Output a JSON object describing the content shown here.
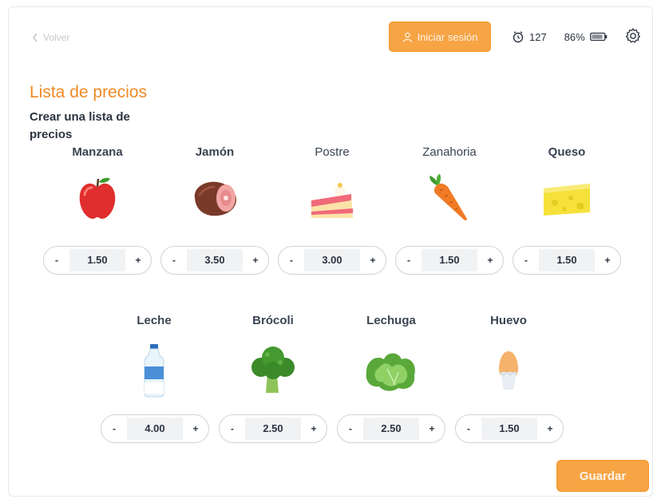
{
  "header": {
    "back_label": "Volver",
    "login_label": "Iniciar sesión",
    "counter": "127",
    "battery": "86%"
  },
  "page": {
    "title": "Lista de precios",
    "subtitle": "Crear una lista de precios"
  },
  "products": [
    {
      "name": "Manzana",
      "value": "1.50",
      "icon": "apple-icon"
    },
    {
      "name": "Jamón",
      "value": "3.50",
      "icon": "ham-icon"
    },
    {
      "name": "Postre",
      "value": "3.00",
      "icon": "cake-icon"
    },
    {
      "name": "Zanahoria",
      "value": "1.50",
      "icon": "carrot-icon"
    },
    {
      "name": "Queso",
      "value": "1.50",
      "icon": "cheese-icon"
    },
    {
      "name": "Leche",
      "value": "4.00",
      "icon": "milk-icon"
    },
    {
      "name": "Brócoli",
      "value": "2.50",
      "icon": "broccoli-icon"
    },
    {
      "name": "Lechuga",
      "value": "2.50",
      "icon": "lettuce-icon"
    },
    {
      "name": "Huevo",
      "value": "1.50",
      "icon": "egg-icon"
    }
  ],
  "stepper": {
    "minus": "-",
    "plus": "+"
  },
  "save_label": "Guardar",
  "colors": {
    "accent": "#f7a445",
    "title": "#f08a24"
  }
}
